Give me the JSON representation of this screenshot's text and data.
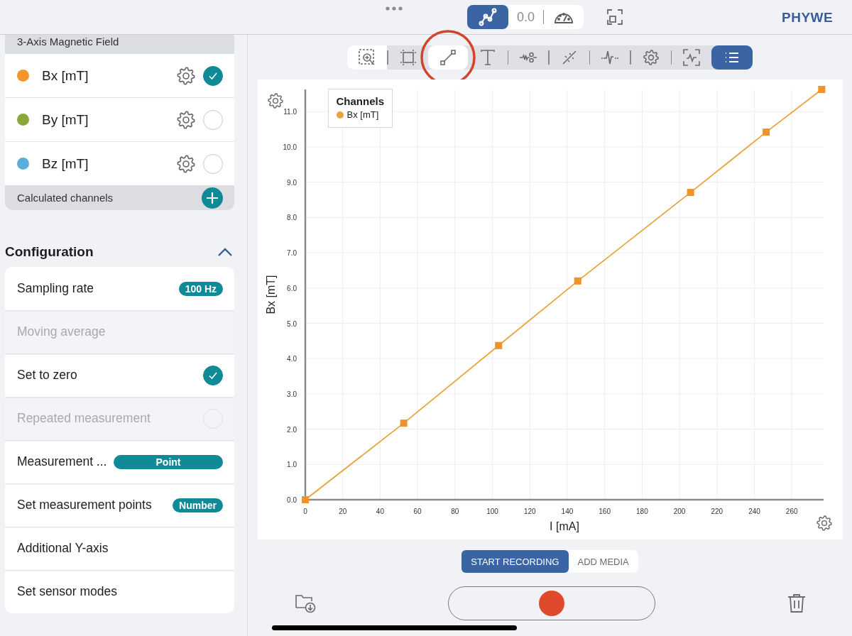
{
  "top_bar": {
    "modes": [
      {
        "kind": "graph",
        "selected": true
      },
      {
        "kind": "value",
        "label": "0.0",
        "selected": false
      },
      {
        "kind": "gauge",
        "selected": false
      }
    ],
    "brand": "PHYWE"
  },
  "sensor": {
    "title": "3-Axis Magnetic Field",
    "channels": [
      {
        "name": "Bx [mT]",
        "color": "#f0962a",
        "checked": true
      },
      {
        "name": "By [mT]",
        "color": "#8aa83a",
        "checked": false
      },
      {
        "name": "Bz [mT]",
        "color": "#5aaedc",
        "checked": false
      }
    ],
    "calculated": "Calculated channels"
  },
  "configuration": {
    "title": "Configuration",
    "expanded": true,
    "rows": [
      {
        "kind": "badge",
        "label": "Sampling rate",
        "value": "100 Hz",
        "disabled": false
      },
      {
        "kind": "plain",
        "label": "Moving average",
        "disabled": true
      },
      {
        "kind": "check",
        "label": "Set to zero",
        "checked": true,
        "disabled": false
      },
      {
        "kind": "check",
        "label": "Repeated measurement",
        "checked": false,
        "disabled": true
      },
      {
        "kind": "wide-badge",
        "label": "Measurement ...",
        "value": "Point",
        "disabled": false
      },
      {
        "kind": "badge",
        "label": "Set measurement points",
        "value": "Number",
        "disabled": false
      },
      {
        "kind": "plain",
        "label": "Additional Y-axis",
        "disabled": false
      },
      {
        "kind": "plain",
        "label": "Set sensor modes",
        "disabled": false
      }
    ]
  },
  "tools": [
    {
      "kind": "zoom",
      "selected": false
    },
    {
      "kind": "fit",
      "selected": false
    },
    {
      "kind": "line",
      "selected": true,
      "highlighted": true
    },
    {
      "kind": "text",
      "selected": false
    },
    {
      "kind": "wave",
      "selected": false
    },
    {
      "kind": "slope",
      "selected": false
    },
    {
      "kind": "signal",
      "selected": false
    },
    {
      "kind": "settings",
      "selected": false
    },
    {
      "kind": "scan",
      "selected": false
    },
    {
      "kind": "list",
      "on": true
    }
  ],
  "chart": {
    "legend_title": "Channels",
    "chart_data": {
      "type": "line",
      "xlabel": "I [mA]",
      "ylabel": "Bx [mT]",
      "x": [
        0,
        52.6,
        103.3,
        145.6,
        205.9,
        246.3,
        276
      ],
      "grid": true,
      "series": [
        {
          "name": "Bx [mT]",
          "color": "#e8a33a",
          "marker": "square",
          "values": [
            0,
            2.17,
            4.37,
            6.2,
            8.71,
            10.42,
            11.63
          ]
        }
      ],
      "xlim": [
        0,
        277
      ],
      "ylim": [
        0,
        11.63
      ],
      "xticks": [
        0,
        20,
        40,
        60,
        80,
        100,
        120,
        140,
        160,
        180,
        200,
        220,
        240,
        260
      ],
      "yticks": [
        {
          "value": 0,
          "label": "0.0"
        },
        {
          "value": 1,
          "label": "1.0"
        },
        {
          "value": 2,
          "label": "2.0"
        },
        {
          "value": 3,
          "label": "3.0"
        },
        {
          "value": 4,
          "label": "4.0"
        },
        {
          "value": 5,
          "label": "5.0"
        },
        {
          "value": 6,
          "label": "6.0"
        },
        {
          "value": 7,
          "label": "7.0"
        },
        {
          "value": 8,
          "label": "8.0"
        },
        {
          "value": 9,
          "label": "9.0"
        },
        {
          "value": 10,
          "label": "10.0"
        },
        {
          "value": 11,
          "label": "11.0"
        }
      ]
    }
  },
  "record_tabs": [
    {
      "label": "START RECORDING",
      "selected": true
    },
    {
      "label": "ADD MEDIA",
      "selected": false
    }
  ]
}
